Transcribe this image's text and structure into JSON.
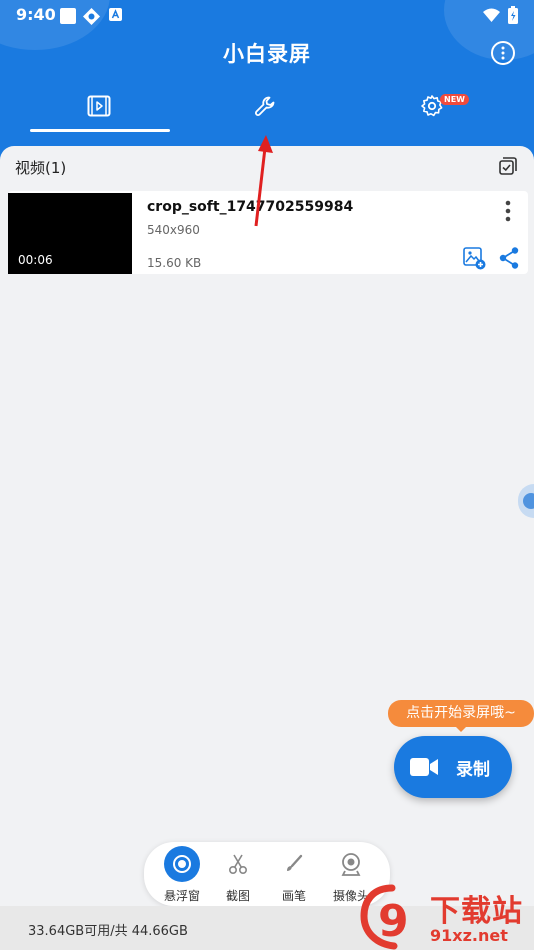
{
  "status_bar": {
    "time": "9:40"
  },
  "app": {
    "title": "小白录屏"
  },
  "tabs": [
    {
      "name": "videos",
      "icon": "video-file-icon"
    },
    {
      "name": "tools",
      "icon": "wrench-icon"
    },
    {
      "name": "settings",
      "icon": "gear-icon",
      "badge": "NEW"
    }
  ],
  "section": {
    "title": "视频(1)"
  },
  "videos": [
    {
      "name": "crop_soft_1747702559984",
      "resolution": "540x960",
      "size": "15.60 KB",
      "duration": "00:06"
    }
  ],
  "tooltip": "点击开始录屏哦~",
  "record_button": {
    "label": "录制",
    "icon": "video-camera-icon"
  },
  "toolbar": [
    {
      "label": "悬浮窗",
      "icon": "floating-window-icon",
      "active": true
    },
    {
      "label": "截图",
      "icon": "scissors-icon",
      "active": false
    },
    {
      "label": "画笔",
      "icon": "brush-icon",
      "active": false
    },
    {
      "label": "摄像头",
      "icon": "webcam-icon",
      "active": false
    }
  ],
  "storage": "33.64GB可用/共 44.66GB",
  "watermark": {
    "logo": "9",
    "text1": "下载站",
    "text2": "91xz.net"
  },
  "colors": {
    "primary": "#1a7ae0",
    "tooltip": "#f58b3c",
    "arrow": "#e02020",
    "badge": "#f04b3c",
    "background": "#f1f2f4"
  }
}
